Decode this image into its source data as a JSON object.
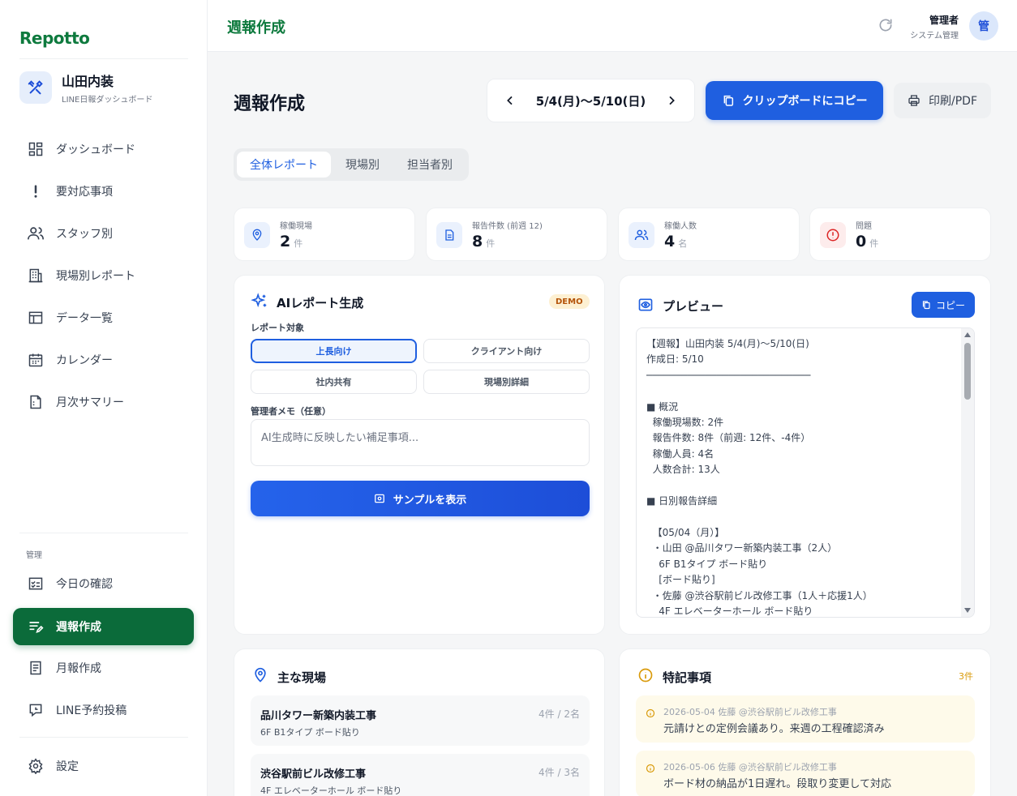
{
  "sidebar": {
    "logo": "Repotto",
    "company_name": "山田内装",
    "company_sub": "LINE日報ダッシュボード",
    "nav": [
      {
        "label": "ダッシュボード",
        "icon": "dashboard-icon"
      },
      {
        "label": "要対応事項",
        "icon": "exclamation-icon"
      },
      {
        "label": "スタッフ別",
        "icon": "users-icon"
      },
      {
        "label": "現場別レポート",
        "icon": "building-icon"
      },
      {
        "label": "データ一覧",
        "icon": "table-icon"
      },
      {
        "label": "カレンダー",
        "icon": "calendar-icon"
      },
      {
        "label": "月次サマリー",
        "icon": "document-icon"
      }
    ],
    "section_label": "管理",
    "admin_nav": [
      {
        "label": "今日の確認",
        "icon": "checklist-icon"
      },
      {
        "label": "週報作成",
        "icon": "edit-list-icon",
        "active": true
      },
      {
        "label": "月報作成",
        "icon": "report-icon"
      },
      {
        "label": "LINE予約投稿",
        "icon": "schedule-post-icon"
      }
    ],
    "settings": "設定"
  },
  "header": {
    "title": "週報作成",
    "user_name": "管理者",
    "user_role": "システム管理",
    "avatar": "管"
  },
  "main": {
    "title": "週報作成",
    "week_label": "5/4(月)〜5/10(日)",
    "copy_button": "クリップボードにコピー",
    "print_button": "印刷/PDF",
    "tabs": [
      "全体レポート",
      "現場別",
      "担当者別"
    ],
    "stats": [
      {
        "label": "稼働現場",
        "value": "2",
        "unit": "件"
      },
      {
        "label": "報告件数 (前週 12)",
        "value": "8",
        "unit": "件"
      },
      {
        "label": "稼働人数",
        "value": "4",
        "unit": "名"
      },
      {
        "label": "問題",
        "value": "0",
        "unit": "件"
      }
    ]
  },
  "ai_card": {
    "title": "AIレポート生成",
    "badge": "DEMO",
    "target_label": "レポート対象",
    "options": [
      "上長向け",
      "クライアント向け",
      "社内共有",
      "現場別詳細"
    ],
    "memo_label": "管理者メモ（任意）",
    "memo_placeholder": "AI生成時に反映したい補足事項...",
    "sample_button": "サンプルを表示"
  },
  "preview_card": {
    "title": "プレビュー",
    "copy_button": "コピー",
    "text": "【週報】山田内装 5/4(月)〜5/10(日)\n作成日: 5/10\n────────────────────────────\n\n■ 概況\n  稼働現場数: 2件\n  報告件数: 8件（前週: 12件、-4件）\n  稼働人員: 4名\n  人数合計: 13人\n\n■ 日別報告詳細\n\n  【05/04（月）】\n  ・山田 @品川タワー新築内装工事（2人）\n    6F B1タイプ ボード貼り\n    [ボード貼り]\n  ・佐藤 @渋谷駅前ビル改修工事（1人＋応援1人）\n    4F エレベーターホール ボード貼り"
  },
  "sites_card": {
    "title": "主な現場",
    "items": [
      {
        "name": "品川タワー新築内装工事",
        "meta": "4件 / 2名",
        "sub": "6F B1タイプ ボード貼り"
      },
      {
        "name": "渋谷駅前ビル改修工事",
        "meta": "4件 / 3名",
        "sub": "4F エレベーターホール ボード貼り"
      }
    ]
  },
  "notes_card": {
    "title": "特記事項",
    "count": "3件",
    "items": [
      {
        "meta": "2026-05-04 佐藤 @渋谷駅前ビル改修工事",
        "text": "元請けとの定例会議あり。来週の工程確認済み"
      },
      {
        "meta": "2026-05-06 佐藤 @渋谷駅前ビル改修工事",
        "text": "ボード材の納品が1日遅れ。段取り変更して対応"
      }
    ]
  },
  "colors": {
    "brand_green": "#0e7a3e",
    "primary_blue": "#1f5fe0",
    "active_nav": "#0b6b3a",
    "warning": "#d99a0a",
    "danger": "#dc2626"
  }
}
